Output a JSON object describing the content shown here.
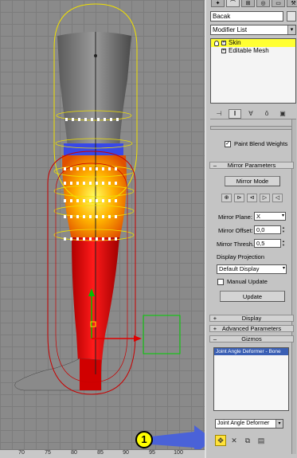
{
  "colors": {
    "selection_yellow": "#ffff33",
    "callout_yellow": "#ffff00",
    "list_highlight": "#3a5fb4",
    "callout_arrow": "#4a62d8",
    "leg_red": "#e00000",
    "envelope_yellow": "#f0e000"
  },
  "viewport": {
    "ruler_ticks": [
      "70",
      "75",
      "80",
      "85",
      "90",
      "95",
      "100"
    ]
  },
  "command_panel": {
    "tabs": [
      "create-icon",
      "modify-icon",
      "hierarchy-icon",
      "motion-icon",
      "display-icon",
      "utilities-icon"
    ],
    "object_name": "Bacak",
    "modifier_list": "Modifier List",
    "stack": [
      "Skin",
      "Editable Mesh"
    ],
    "stack_tools": [
      "pin-stack-icon",
      "show-end-result-icon",
      "make-unique-icon",
      "remove-modifier-icon",
      "configure-sets-icon"
    ],
    "paint_blend_weights": "Paint Blend Weights",
    "mirror_parameters": {
      "title": "Mirror Parameters",
      "mirror_mode": "Mirror Mode",
      "icons": [
        "mirror-paste-icon",
        "paste-green-to-blue-bones-icon",
        "paste-blue-to-green-bones-icon",
        "paste-green-to-blue-verts-icon",
        "paste-blue-to-green-verts-icon"
      ],
      "mirror_plane_label": "Mirror Plane:",
      "mirror_plane_value": "X",
      "mirror_offset_label": "Mirror Offset:",
      "mirror_offset_value": "0,0",
      "mirror_thresh_label": "Mirror Thresh.:",
      "mirror_thresh_value": "0,5",
      "display_projection_label": "Display Projection",
      "display_projection_value": "Default Display",
      "manual_update": "Manual Update",
      "update": "Update"
    },
    "rollouts": {
      "display": "Display",
      "advanced_parameters": "Advanced Parameters",
      "gizmos": "Gizmos"
    },
    "gizmo_list": [
      "Joint Angle Deformer - Bone"
    ],
    "gizmo_type": "Joint Angle Deformer",
    "gizmo_tools": [
      "add-gizmo-icon",
      "remove-gizmo-icon",
      "copy-gizmo-icon",
      "paste-gizmo-icon"
    ]
  },
  "callout": {
    "number": "1"
  }
}
